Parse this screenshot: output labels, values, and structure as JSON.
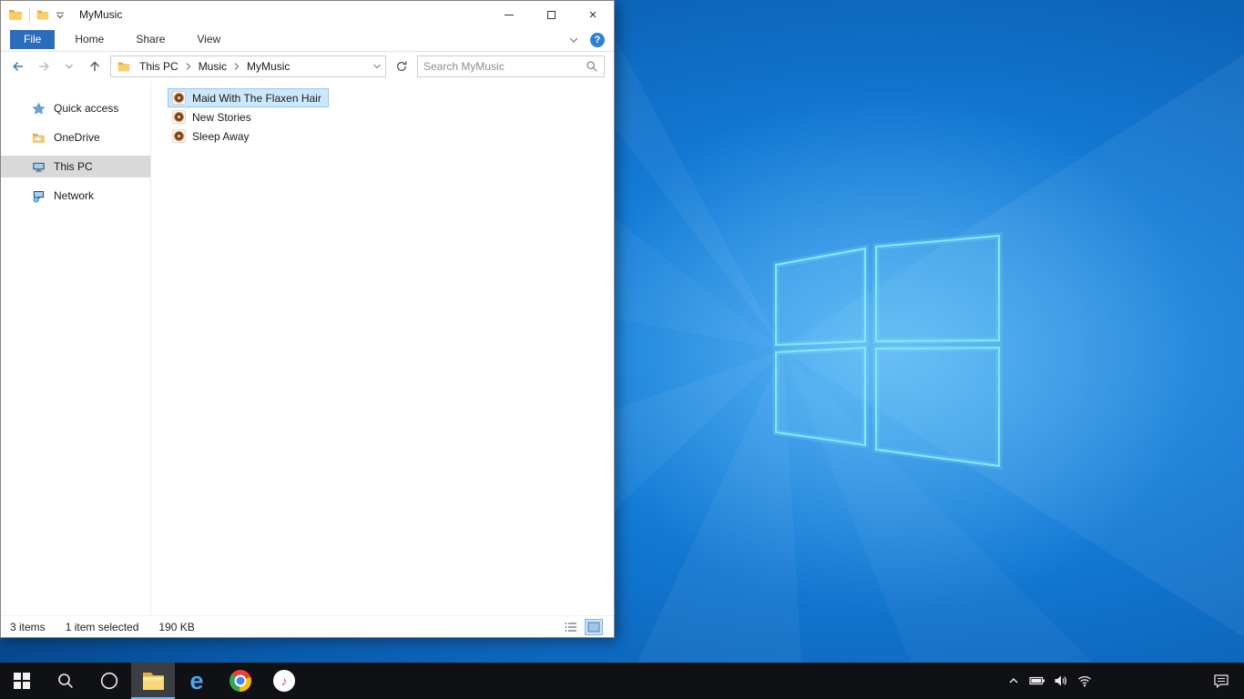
{
  "window": {
    "title": "MyMusic",
    "icon": "folder-icon",
    "controls": [
      "minimize",
      "maximize",
      "close"
    ]
  },
  "ribbon": {
    "tabs": [
      {
        "label": "File",
        "active": true
      },
      {
        "label": "Home",
        "active": false
      },
      {
        "label": "Share",
        "active": false
      },
      {
        "label": "View",
        "active": false
      }
    ],
    "collapse_icon": "chevron-down-icon",
    "help_icon": "help-icon"
  },
  "toolbar_icons": [
    "back-arrow-icon",
    "forward-arrow-icon",
    "recent-locations-chevron-icon",
    "up-arrow-icon",
    "refresh-icon"
  ],
  "address": {
    "location_icon": "folder-icon",
    "breadcrumb": [
      "This PC",
      "Music",
      "MyMusic"
    ],
    "dropdown_icon": "chevron-down-icon",
    "search": {
      "placeholder": "Search MyMusic",
      "icon": "search-icon"
    }
  },
  "sidebar": {
    "items": [
      {
        "label": "Quick access",
        "icon": "star-icon",
        "selected": false
      },
      {
        "label": "OneDrive",
        "icon": "onedrive-icon",
        "selected": false
      },
      {
        "label": "This PC",
        "icon": "computer-icon",
        "selected": true
      },
      {
        "label": "Network",
        "icon": "network-icon",
        "selected": false
      }
    ]
  },
  "files": [
    {
      "name": "Maid With The Flaxen Hair",
      "icon": "music-file-icon",
      "selected": true
    },
    {
      "name": "New Stories",
      "icon": "music-file-icon",
      "selected": false
    },
    {
      "name": "Sleep Away",
      "icon": "music-file-icon",
      "selected": false
    }
  ],
  "statusbar": {
    "items_count": "3 items",
    "selection": "1 item selected",
    "size": "190 KB",
    "view_icons": [
      "details-view-icon",
      "large-icons-view-icon"
    ]
  },
  "taskbar": {
    "buttons": [
      {
        "icon": "start-icon",
        "active": false
      },
      {
        "icon": "search-icon",
        "active": false
      },
      {
        "icon": "cortana-icon",
        "active": false
      },
      {
        "icon": "file-explorer-icon",
        "active": true
      },
      {
        "icon": "edge-icon",
        "active": false
      },
      {
        "icon": "chrome-icon",
        "active": false
      },
      {
        "icon": "itunes-icon",
        "active": false
      }
    ],
    "tray_icons": [
      "chevron-up-icon",
      "battery-icon",
      "speaker-icon",
      "wifi-icon",
      "action-center-icon"
    ]
  },
  "colors": {
    "ribbon_file_tab": "#2a6cbd",
    "selection_bg": "#cce8ff",
    "selection_border": "#90c8f6",
    "sidebar_selected": "#d9d9d9",
    "taskbar_bg": "#101114",
    "taskbar_active_underline": "#76b9ed",
    "wallpaper_blue": "#0d6ec9",
    "logo_stroke": "#86e7ff"
  }
}
